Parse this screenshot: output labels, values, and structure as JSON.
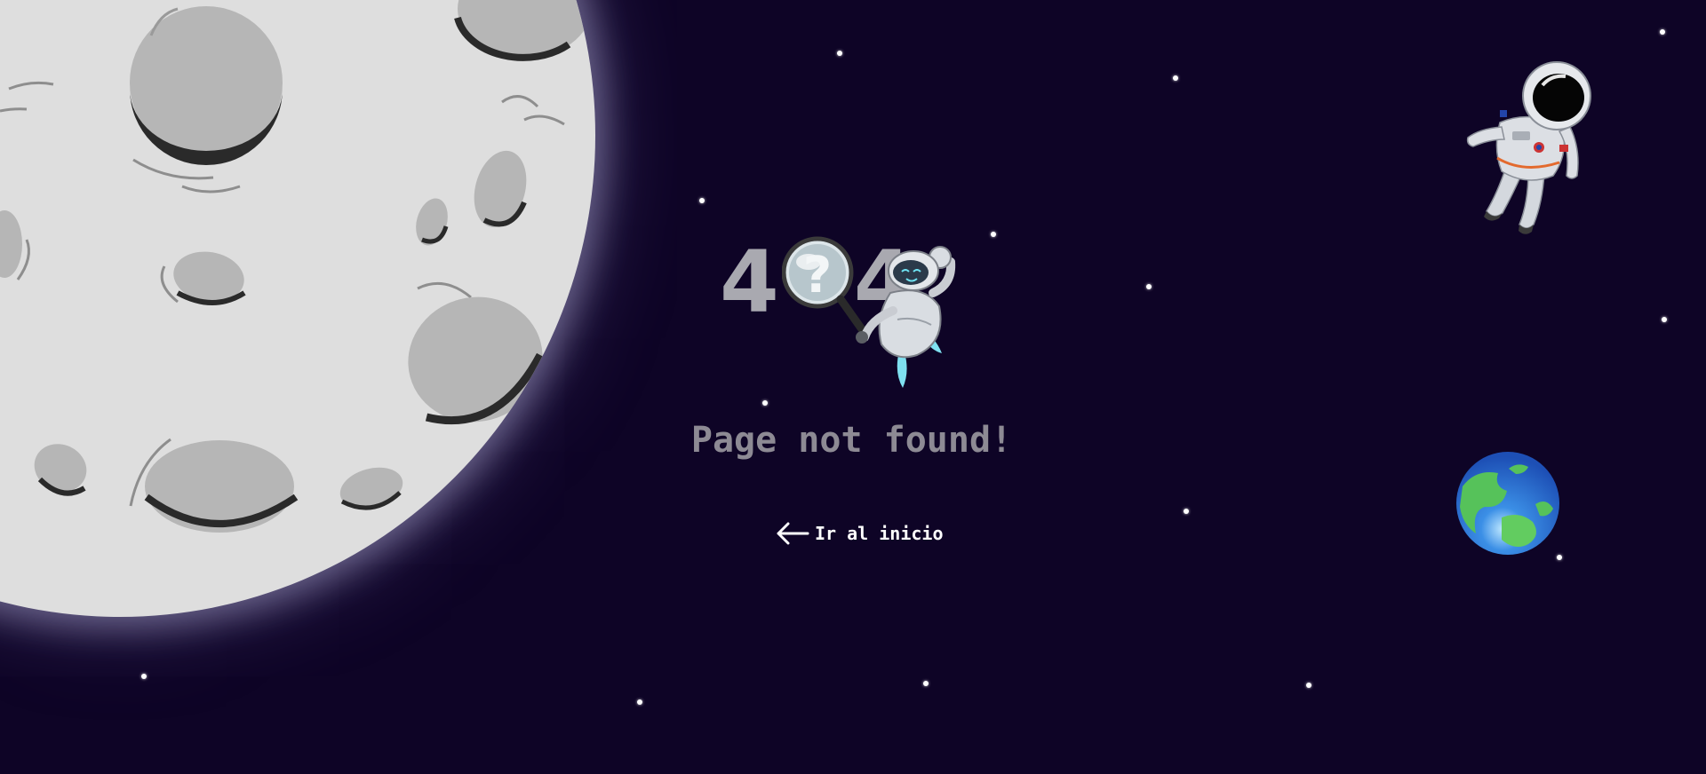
{
  "error": {
    "code_left": "4",
    "code_right": "4",
    "message": "Page not found!"
  },
  "nav": {
    "home_label": "Ir al inicio",
    "arrow_icon": "arrow-left-icon"
  },
  "colors": {
    "background": "#0e0426",
    "moon": "#dedede",
    "message_text": "#8d8a94",
    "code_text": "#a9a9b0",
    "link_text": "#ffffff"
  },
  "illustrations": {
    "moon": "moon-icon",
    "robot": "robot-icon",
    "magnifier": "magnifying-glass-icon",
    "astronaut": "astronaut-icon",
    "earth": "earth-icon",
    "stars": "star-icon"
  }
}
